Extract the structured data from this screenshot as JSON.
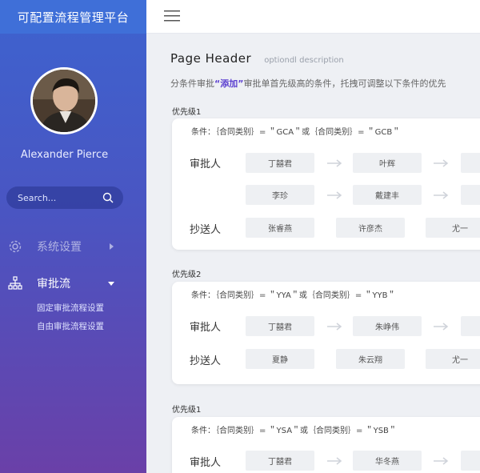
{
  "sidebar": {
    "title": "可配置流程管理平台",
    "user_name": "Alexander Pierce",
    "search_placeholder": "Search...",
    "menu": [
      {
        "label": "系统设置",
        "icon": "gear-icon",
        "state": "collapsed"
      },
      {
        "label": "审批流",
        "icon": "sitemap-icon",
        "state": "expanded",
        "children": [
          "固定审批流程设置",
          "自由审批流程设置"
        ]
      }
    ]
  },
  "header": {
    "title": "Page  Header",
    "description": "optiondl description"
  },
  "hint": {
    "prefix": "分条件审批",
    "highlight": "“添加”",
    "suffix": "审批单首先级高的条件，托拽可调整以下条件的优先"
  },
  "groups": [
    {
      "label": "优先级1",
      "condition": "条件：｛合同类别｝= ＂GCA＂或｛合同类别｝= ＂GCB＂",
      "approver_label": "审批人",
      "approver_rows": [
        [
          "丁囍君",
          "叶辉"
        ],
        [
          "李珍",
          "戴建丰"
        ]
      ],
      "cc_label": "抄送人",
      "cc": [
        "张睿燕",
        "许彦杰",
        "尤一"
      ]
    },
    {
      "label": "优先级2",
      "condition": "条件：｛合同类别｝= ＂YYA＂或｛合同类别｝= ＂YYB＂",
      "approver_label": "审批人",
      "approver_rows": [
        [
          "丁囍君",
          "朱峥伟"
        ]
      ],
      "cc_label": "抄送人",
      "cc": [
        "夏静",
        "朱云翔",
        "尤一"
      ]
    },
    {
      "label": "优先级1",
      "condition": "条件：｛合同类别｝= ＂YSA＂或｛合同类别｝= ＂YSB＂",
      "approver_label": "审批人",
      "approver_rows": [
        [
          "丁囍君",
          "华冬燕"
        ]
      ]
    }
  ]
}
